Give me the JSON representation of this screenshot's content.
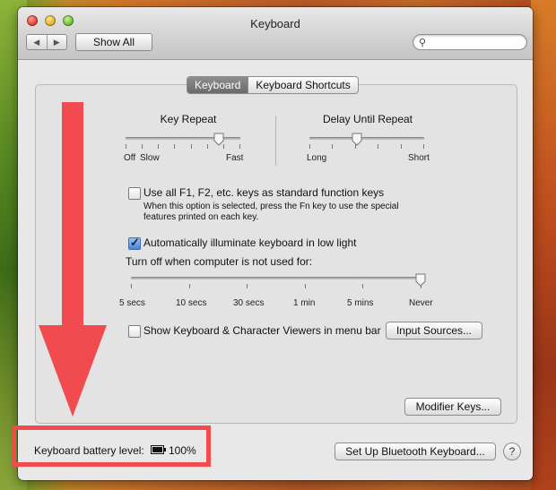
{
  "window": {
    "title": "Keyboard"
  },
  "toolbar": {
    "show_all_label": "Show All",
    "search_placeholder": ""
  },
  "tabs": [
    {
      "label": "Keyboard",
      "active": true
    },
    {
      "label": "Keyboard Shortcuts",
      "active": false
    }
  ],
  "key_repeat": {
    "title": "Key Repeat",
    "labels": {
      "off": "Off",
      "slow": "Slow",
      "fast": "Fast"
    },
    "value_fraction": 0.8
  },
  "delay_until_repeat": {
    "title": "Delay Until Repeat",
    "labels": {
      "long": "Long",
      "short": "Short"
    },
    "value_fraction": 0.4
  },
  "fn_keys": {
    "label": "Use all F1, F2, etc. keys as standard function keys",
    "description_line1": "When this option is selected, press the Fn key to use the special",
    "description_line2": "features printed on each key.",
    "checked": false
  },
  "illuminate": {
    "label": "Automatically illuminate keyboard in low light",
    "checked": true,
    "turn_off_label": "Turn off when computer is not used for:",
    "ticks": [
      "5 secs",
      "10 secs",
      "30 secs",
      "1 min",
      "5 mins",
      "Never"
    ],
    "selected": "Never"
  },
  "viewers": {
    "label": "Show Keyboard & Character Viewers in menu bar",
    "checked": false
  },
  "buttons": {
    "input_sources": "Input Sources...",
    "modifier_keys": "Modifier Keys...",
    "bluetooth": "Set Up Bluetooth Keyboard...",
    "help": "?"
  },
  "battery": {
    "label": "Keyboard battery level:",
    "value": "100%"
  },
  "annotation": {
    "color": "#f24b4f"
  }
}
